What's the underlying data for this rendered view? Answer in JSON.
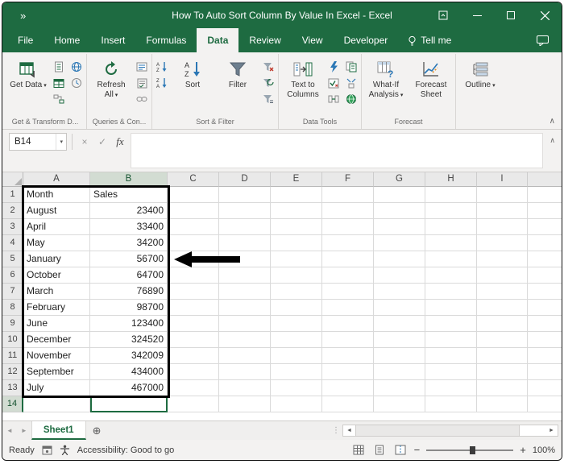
{
  "window": {
    "title": "How To Auto Sort Column By Value In Excel - Excel",
    "quick_access_label": "»"
  },
  "tabs": {
    "items": [
      "File",
      "Home",
      "Insert",
      "Formulas",
      "Data",
      "Review",
      "View",
      "Developer"
    ],
    "active": "Data",
    "tell_me": "Tell me"
  },
  "ribbon": {
    "get_data_label": "Get Data",
    "refresh_all_label": "Refresh All",
    "sort_label": "Sort",
    "filter_label": "Filter",
    "text_to_columns_label": "Text to Columns",
    "what_if_label": "What-If Analysis",
    "forecast_sheet_label": "Forecast Sheet",
    "outline_label": "Outline",
    "group_labels": {
      "get_transform": "Get & Transform D...",
      "queries": "Queries & Con...",
      "sort_filter": "Sort & Filter",
      "data_tools": "Data Tools",
      "forecast": "Forecast",
      "outline": ""
    }
  },
  "formula_bar": {
    "name_box": "B14",
    "fx": "fx",
    "value": ""
  },
  "sheet": {
    "name_box": "B14",
    "columns": [
      "A",
      "B",
      "C",
      "D",
      "E",
      "F",
      "G",
      "H",
      "I"
    ],
    "rows": [
      {
        "n": 1,
        "A": "Month",
        "B": "Sales"
      },
      {
        "n": 2,
        "A": "August",
        "B": "23400"
      },
      {
        "n": 3,
        "A": "April",
        "B": "33400"
      },
      {
        "n": 4,
        "A": "May",
        "B": "34200"
      },
      {
        "n": 5,
        "A": "January",
        "B": "56700"
      },
      {
        "n": 6,
        "A": "October",
        "B": "64700"
      },
      {
        "n": 7,
        "A": "March",
        "B": "76890"
      },
      {
        "n": 8,
        "A": "February",
        "B": "98700"
      },
      {
        "n": 9,
        "A": "June",
        "B": "123400"
      },
      {
        "n": 10,
        "A": "December",
        "B": "324520"
      },
      {
        "n": 11,
        "A": "November",
        "B": "342009"
      },
      {
        "n": 12,
        "A": "September",
        "B": "434000"
      },
      {
        "n": 13,
        "A": "July",
        "B": "467000"
      },
      {
        "n": 14,
        "A": "",
        "B": ""
      }
    ]
  },
  "sheet_tabs": {
    "active": "Sheet1"
  },
  "status_bar": {
    "ready": "Ready",
    "accessibility": "Accessibility: Good to go",
    "zoom": "100%"
  },
  "colors": {
    "excel_green": "#1e6b41",
    "ribbon_bg": "#f3f2f1",
    "selection_border": "#000000"
  }
}
